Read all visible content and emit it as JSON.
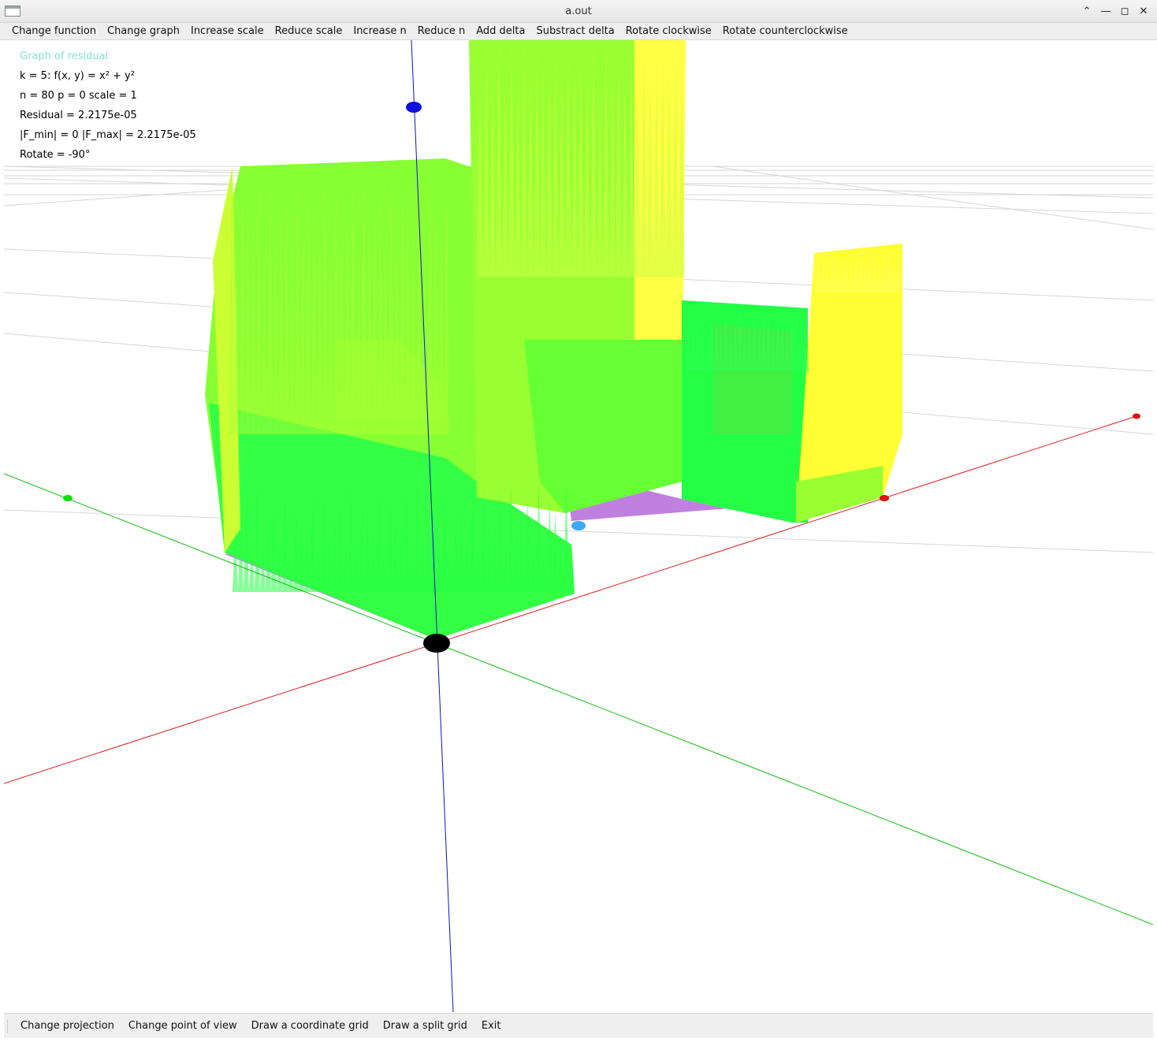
{
  "window": {
    "title": "a.out"
  },
  "menu": [
    "Change function",
    "Change graph",
    "Increase scale",
    "Reduce scale",
    "Increase n",
    "Reduce n",
    "Add delta",
    "Substract delta",
    "Rotate clockwise",
    "Rotate counterclockwise"
  ],
  "info": {
    "caption": "Graph of residual",
    "func": "k = 5: f(x, y) = x² + y²",
    "params": "n = 80   p = 0   scale = 1",
    "residual": "Residual = 2.2175e-05",
    "fminmax": "|F_min| = 0   |F_max| = 2.2175e-05",
    "rotate": "Rotate = -90°"
  },
  "toolbar": [
    "Change projection",
    "Change point of view",
    "Draw a coordinate grid",
    "Draw a split grid",
    "Exit"
  ],
  "colors": {
    "x_axis": "#e02020",
    "y_axis": "#10c010",
    "z_axis": "#1010d0",
    "base": "#c080e0",
    "surface_green": "#22ff44",
    "surface_lime": "#99ff33",
    "surface_yellow": "#ffff33"
  }
}
